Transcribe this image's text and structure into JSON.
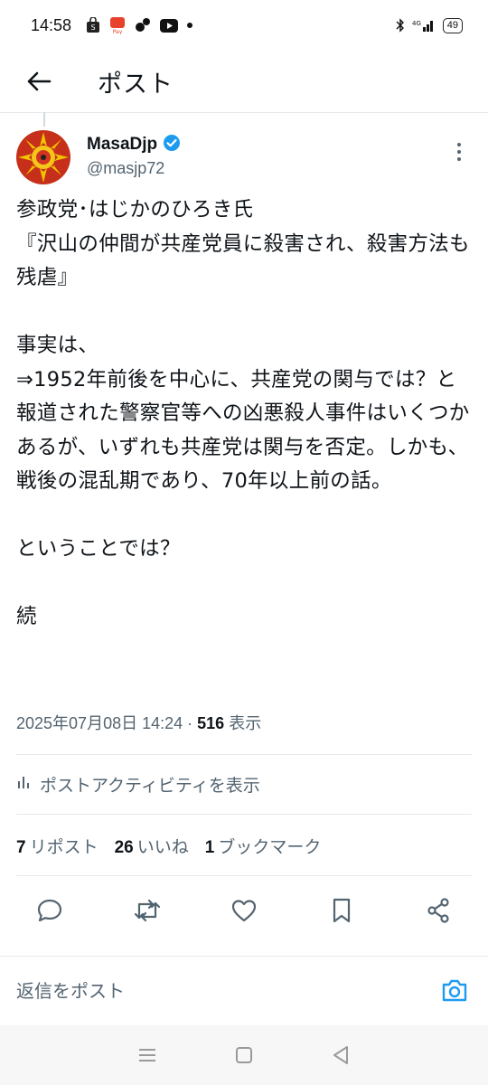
{
  "status_bar": {
    "time": "14:58",
    "network": "4G",
    "battery": "49",
    "icons": [
      "shopping-bag-icon",
      "paypay-icon",
      "threads-icon",
      "youtube-icon",
      "dot-icon",
      "bluetooth-icon",
      "signal-icon",
      "battery-icon"
    ]
  },
  "header": {
    "title": "ポスト"
  },
  "author": {
    "display_name": "MasaDjp",
    "handle": "@masjp72",
    "verified": true
  },
  "post": {
    "text": "参政党･はじかのひろき氏\n『沢山の仲間が共産党員に殺害され、殺害方法も残虐』\n\n事実は、\n⇒1952年前後を中心に、共産党の関与では？と報道された警察官等への凶悪殺人事件はいくつかあるが、いずれも共産党は関与を否定。しかも、戦後の混乱期であり、70年以上前の話。\n\nということでは？\n\n続",
    "timestamp": "2025年07月08日 14:24",
    "separator": " · ",
    "views_count": "516",
    "views_label": " 表示"
  },
  "activity": {
    "label": "ポストアクティビティを表示"
  },
  "counts": {
    "reposts": "7",
    "reposts_label": "リポスト",
    "likes": "26",
    "likes_label": "いいね",
    "bookmarks": "1",
    "bookmarks_label": "ブックマーク"
  },
  "reply": {
    "placeholder": "返信をポスト"
  },
  "colors": {
    "accent": "#1d9bf0",
    "text": "#0f1419",
    "muted": "#536471",
    "divider": "#e6e9ec"
  }
}
